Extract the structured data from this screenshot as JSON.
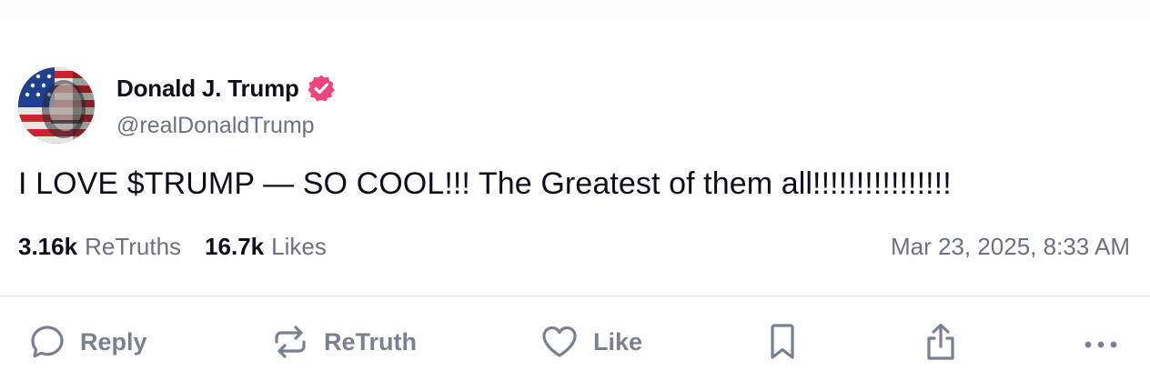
{
  "author": {
    "name": "Donald J. Trump",
    "handle": "@realDonaldTrump",
    "verified": true,
    "verified_color": "#f0447a"
  },
  "post": {
    "text": "I LOVE $TRUMP — SO COOL!!! The Greatest of them all!!!!!!!!!!!!!!!!",
    "timestamp": "Mar 23, 2025, 8:33 AM"
  },
  "stats": {
    "retruths_count": "3.16k",
    "retruths_label": "ReTruths",
    "likes_count": "16.7k",
    "likes_label": "Likes"
  },
  "actions": {
    "reply_label": "Reply",
    "retruth_label": "ReTruth",
    "like_label": "Like",
    "icons": [
      "reply-icon",
      "retruth-icon",
      "like-heart-icon",
      "bookmark-icon",
      "share-icon",
      "more-icon"
    ]
  },
  "colors": {
    "text_primary": "#0f0f1a",
    "text_secondary": "#6b7180",
    "action_gray": "#7a8090",
    "divider": "#e3e5ea"
  }
}
